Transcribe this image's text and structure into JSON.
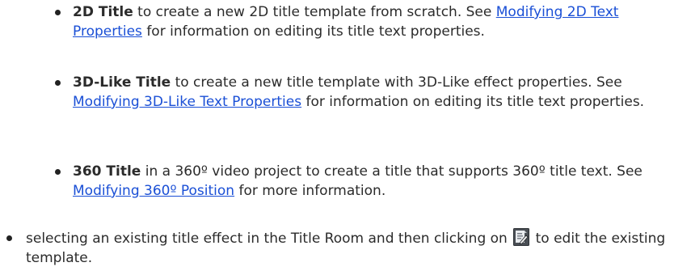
{
  "items": [
    {
      "bold": "2D Title",
      "text_before": " to create a new 2D title template from scratch. See ",
      "link": "Modifying 2D Text Properties",
      "text_after": " for information on editing its title text properties."
    },
    {
      "bold": "3D-Like Title",
      "text_before": " to create a new title template with 3D-Like effect properties. See ",
      "link": "Modifying 3D-Like Text Properties",
      "text_after": " for information on editing its title text properties."
    },
    {
      "bold": "360 Title",
      "text_before": " in a 360º video project to create a title that supports 360º title text. See ",
      "link": "Modifying 360º Position",
      "text_after": " for more information."
    }
  ],
  "final_item": {
    "text_before": "selecting an existing title effect in the Title Room and then clicking on ",
    "icon": "edit-title-icon",
    "text_after": " to edit the existing template."
  }
}
